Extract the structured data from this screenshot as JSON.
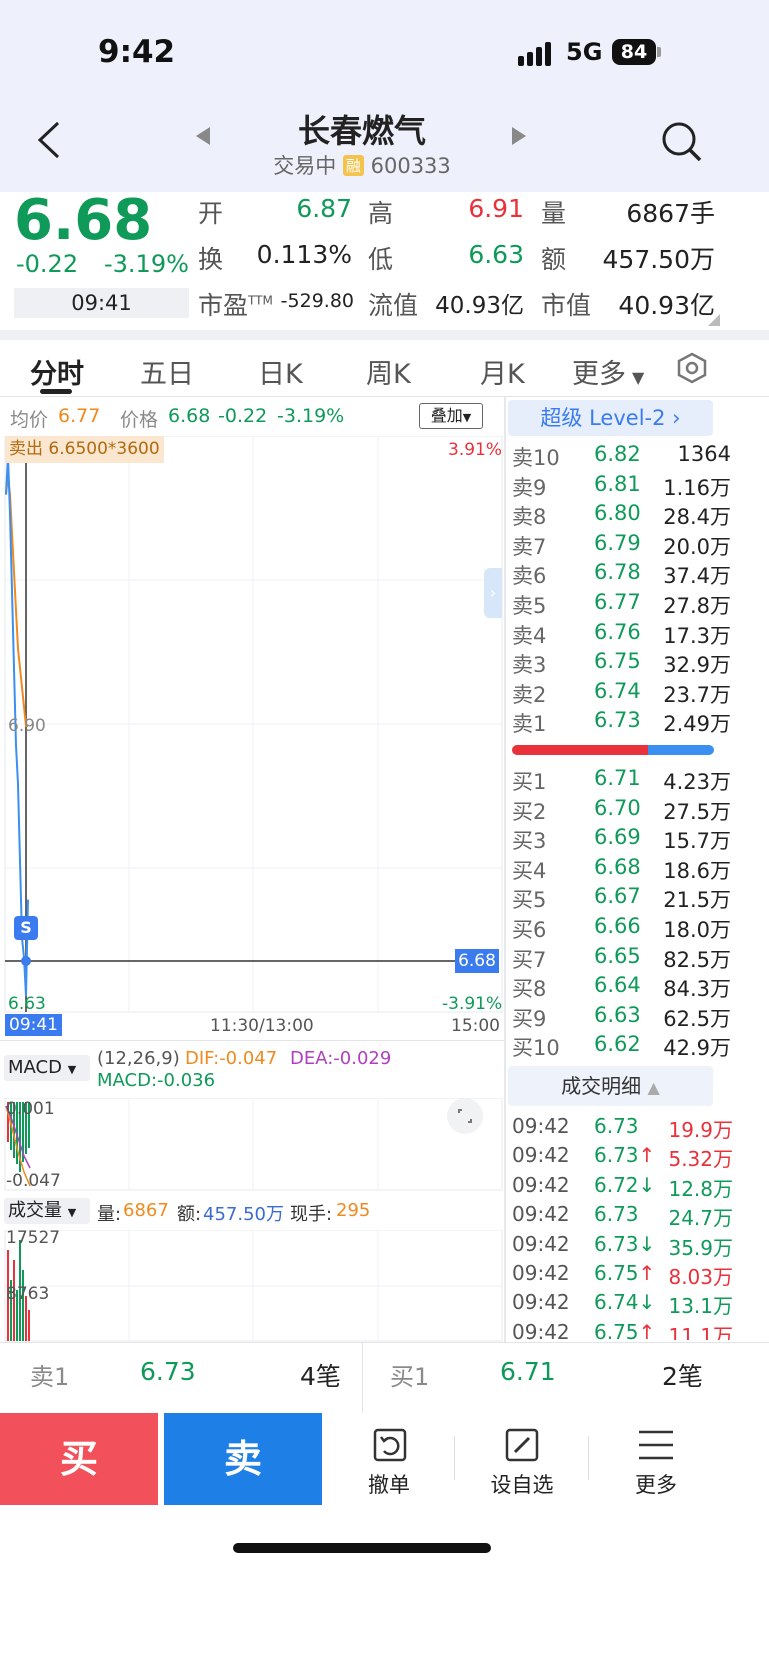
{
  "status": {
    "time": "9:42",
    "network": "5G",
    "battery": "84"
  },
  "nav": {
    "title": "长春燃气",
    "status": "交易中",
    "margin_badge": "融",
    "code": "600333"
  },
  "quote": {
    "price": "6.68",
    "change": "-0.22",
    "change_pct": "-3.19%",
    "time": "09:41",
    "open_label": "开",
    "open": "6.87",
    "high_label": "高",
    "high": "6.91",
    "volume_label": "量",
    "volume": "6867手",
    "turnover_label": "换",
    "turnover": "0.113%",
    "low_label": "低",
    "low": "6.63",
    "amount_label": "额",
    "amount": "457.50万",
    "pe_label": "市盈",
    "pe_sup": "TTM",
    "pe": "-529.80",
    "float_cap_label": "流值",
    "float_cap": "40.93亿",
    "market_cap_label": "市值",
    "market_cap": "40.93亿"
  },
  "tabs": [
    "分时",
    "五日",
    "日K",
    "周K",
    "月K",
    "更多"
  ],
  "chart_header": {
    "avg_label": "均价",
    "avg": "6.77",
    "price_label": "价格",
    "price": "6.68",
    "change": "-0.22",
    "change_pct": "-3.19%",
    "overlay": "叠加"
  },
  "chart": {
    "sell_tag": "卖出 6.6500*3600",
    "pct_top": "3.91%",
    "pct_bottom": "-3.91%",
    "price_mid": "6.90",
    "price_low": "6.63",
    "cursor_price": "6.68",
    "cursor_time": "09:41",
    "x_mid": "11:30/13:00",
    "x_end": "15:00",
    "signal_marker": "S"
  },
  "chart_data": {
    "type": "line",
    "series": [],
    "x": [
      "09:30",
      "09:31",
      "09:32",
      "09:33",
      "09:34",
      "09:35",
      "09:36",
      "09:37",
      "09:38",
      "09:39",
      "09:40",
      "09:41"
    ],
    "price": [
      6.89,
      6.91,
      6.88,
      6.84,
      6.8,
      6.76,
      6.74,
      6.7,
      6.66,
      6.65,
      6.63,
      6.68
    ],
    "avg": [
      6.89,
      6.9,
      6.89,
      6.87,
      6.85,
      6.83,
      6.81,
      6.8,
      6.79,
      6.78,
      6.77,
      6.77
    ],
    "ylim": [
      6.63,
      6.91
    ]
  },
  "macd": {
    "label": "MACD",
    "params": "(12,26,9)",
    "dif": "DIF:-0.047",
    "dea": "DEA:-0.029",
    "macd": "MACD:-0.036",
    "top": "0.001",
    "bottom": "-0.047"
  },
  "vol": {
    "label": "成交量",
    "vol_label": "量:",
    "vol": "6867",
    "amt_label": "额:",
    "amt": "457.50万",
    "hand_label": "现手:",
    "hand": "295",
    "top": "17527",
    "mid": "8763"
  },
  "level2": {
    "label": "超级 Level-2"
  },
  "asks": [
    {
      "label": "卖10",
      "price": "6.82",
      "vol": "1364"
    },
    {
      "label": "卖9",
      "price": "6.81",
      "vol": "1.16万"
    },
    {
      "label": "卖8",
      "price": "6.80",
      "vol": "28.4万"
    },
    {
      "label": "卖7",
      "price": "6.79",
      "vol": "20.0万"
    },
    {
      "label": "卖6",
      "price": "6.78",
      "vol": "37.4万"
    },
    {
      "label": "卖5",
      "price": "6.77",
      "vol": "27.8万"
    },
    {
      "label": "卖4",
      "price": "6.76",
      "vol": "17.3万"
    },
    {
      "label": "卖3",
      "price": "6.75",
      "vol": "32.9万"
    },
    {
      "label": "卖2",
      "price": "6.74",
      "vol": "23.7万"
    },
    {
      "label": "卖1",
      "price": "6.73",
      "vol": "2.49万"
    }
  ],
  "bids": [
    {
      "label": "买1",
      "price": "6.71",
      "vol": "4.23万"
    },
    {
      "label": "买2",
      "price": "6.70",
      "vol": "27.5万"
    },
    {
      "label": "买3",
      "price": "6.69",
      "vol": "15.7万"
    },
    {
      "label": "买4",
      "price": "6.68",
      "vol": "18.6万"
    },
    {
      "label": "买5",
      "price": "6.67",
      "vol": "21.5万"
    },
    {
      "label": "买6",
      "price": "6.66",
      "vol": "18.0万"
    },
    {
      "label": "买7",
      "price": "6.65",
      "vol": "82.5万"
    },
    {
      "label": "买8",
      "price": "6.64",
      "vol": "84.3万"
    },
    {
      "label": "买9",
      "price": "6.63",
      "vol": "62.5万"
    },
    {
      "label": "买10",
      "price": "6.62",
      "vol": "42.9万"
    }
  ],
  "trades_header": "成交明细",
  "trades": [
    {
      "time": "09:42",
      "price": "6.73",
      "arrow": "",
      "amt": "19.9万",
      "color": "#e8313a"
    },
    {
      "time": "09:42",
      "price": "6.73",
      "arrow": "↑",
      "amt": "5.32万",
      "color": "#e8313a"
    },
    {
      "time": "09:42",
      "price": "6.72",
      "arrow": "↓",
      "amt": "12.8万",
      "color": "#0f9a5a"
    },
    {
      "time": "09:42",
      "price": "6.73",
      "arrow": "",
      "amt": "24.7万",
      "color": "#0f9a5a"
    },
    {
      "time": "09:42",
      "price": "6.73",
      "arrow": "↓",
      "amt": "35.9万",
      "color": "#0f9a5a"
    },
    {
      "time": "09:42",
      "price": "6.75",
      "arrow": "↑",
      "amt": "8.03万",
      "color": "#e8313a"
    },
    {
      "time": "09:42",
      "price": "6.74",
      "arrow": "↓",
      "amt": "13.1万",
      "color": "#0f9a5a"
    },
    {
      "time": "09:42",
      "price": "6.75",
      "arrow": "↑",
      "amt": "11.1万",
      "color": "#e8313a"
    }
  ],
  "bottom_quote": {
    "sell_label": "卖1",
    "sell_price": "6.73",
    "sell_count": "4笔",
    "buy_label": "买1",
    "buy_price": "6.71",
    "buy_count": "2笔"
  },
  "actions": {
    "buy": "买",
    "sell": "卖",
    "cancel": "撤单",
    "watchlist": "设自选",
    "more": "更多"
  },
  "colors": {
    "up": "#e8313a",
    "down": "#0f9a5a",
    "accent": "#3a7bf0",
    "buy_btn": "#f2505a",
    "sell_btn": "#1e7fe6"
  }
}
